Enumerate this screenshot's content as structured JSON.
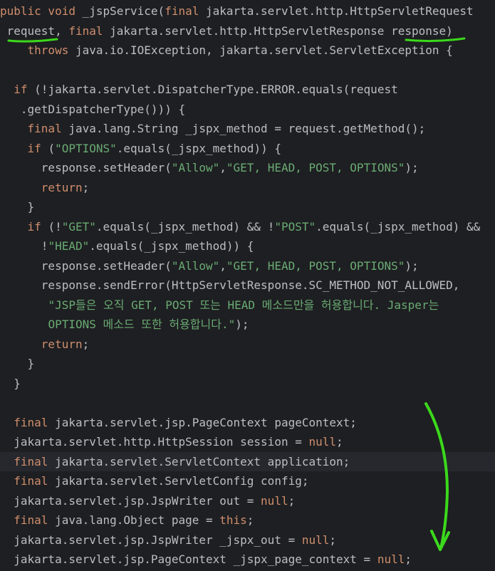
{
  "editor": {
    "language": "java",
    "current_line": 23,
    "colors": {
      "background": "#1e1f22",
      "current_line": "#26282e",
      "text": "#bcbec4",
      "keyword": "#cf8e6d",
      "string": "#6aab73",
      "annotation": "#3bd91b"
    },
    "lines": [
      [
        {
          "t": "public void ",
          "c": "kw"
        },
        {
          "t": "_jspService(",
          "c": "plain"
        },
        {
          "t": "final ",
          "c": "kw"
        },
        {
          "t": "jakarta.servlet.http.HttpServletRequest",
          "c": "plain"
        }
      ],
      [
        {
          "t": " request, ",
          "c": "plain"
        },
        {
          "t": "final ",
          "c": "kw"
        },
        {
          "t": "jakarta.servlet.http.HttpServletResponse response)",
          "c": "plain"
        }
      ],
      [
        {
          "t": "    ",
          "c": "plain"
        },
        {
          "t": "throws ",
          "c": "kw"
        },
        {
          "t": "java.io.IOException, jakarta.servlet.ServletException {",
          "c": "plain"
        }
      ],
      [],
      [
        {
          "t": "  ",
          "c": "plain"
        },
        {
          "t": "if ",
          "c": "kw"
        },
        {
          "t": "(!jakarta.servlet.DispatcherType.ERROR.equals(request",
          "c": "plain"
        }
      ],
      [
        {
          "t": "   .getDispatcherType())) {",
          "c": "plain"
        }
      ],
      [
        {
          "t": "    ",
          "c": "plain"
        },
        {
          "t": "final ",
          "c": "kw"
        },
        {
          "t": "java.lang.String _jspx_method = request.getMethod();",
          "c": "plain"
        }
      ],
      [
        {
          "t": "    ",
          "c": "plain"
        },
        {
          "t": "if ",
          "c": "kw"
        },
        {
          "t": "(",
          "c": "plain"
        },
        {
          "t": "\"OPTIONS\"",
          "c": "str"
        },
        {
          "t": ".equals(_jspx_method)) {",
          "c": "plain"
        }
      ],
      [
        {
          "t": "      response.setHeader(",
          "c": "plain"
        },
        {
          "t": "\"Allow\"",
          "c": "str"
        },
        {
          "t": ",",
          "c": "plain"
        },
        {
          "t": "\"GET, HEAD, POST, OPTIONS\"",
          "c": "str"
        },
        {
          "t": ");",
          "c": "plain"
        }
      ],
      [
        {
          "t": "      ",
          "c": "plain"
        },
        {
          "t": "return",
          "c": "kw"
        },
        {
          "t": ";",
          "c": "plain"
        }
      ],
      [
        {
          "t": "    }",
          "c": "plain"
        }
      ],
      [
        {
          "t": "    ",
          "c": "plain"
        },
        {
          "t": "if ",
          "c": "kw"
        },
        {
          "t": "(!",
          "c": "plain"
        },
        {
          "t": "\"GET\"",
          "c": "str"
        },
        {
          "t": ".equals(_jspx_method) && !",
          "c": "plain"
        },
        {
          "t": "\"POST\"",
          "c": "str"
        },
        {
          "t": ".equals(_jspx_method) &&",
          "c": "plain"
        }
      ],
      [
        {
          "t": "      !",
          "c": "plain"
        },
        {
          "t": "\"HEAD\"",
          "c": "str"
        },
        {
          "t": ".equals(_jspx_method)) {",
          "c": "plain"
        }
      ],
      [
        {
          "t": "      response.setHeader(",
          "c": "plain"
        },
        {
          "t": "\"Allow\"",
          "c": "str"
        },
        {
          "t": ",",
          "c": "plain"
        },
        {
          "t": "\"GET, HEAD, POST, OPTIONS\"",
          "c": "str"
        },
        {
          "t": ");",
          "c": "plain"
        }
      ],
      [
        {
          "t": "      response.sendError(HttpServletResponse.SC_METHOD_NOT_ALLOWED,",
          "c": "plain"
        }
      ],
      [
        {
          "t": "       ",
          "c": "plain"
        },
        {
          "t": "\"JSP들은 오직 GET, POST 또는 HEAD 메소드만을 허용합니다. Jasper는",
          "c": "str"
        }
      ],
      [
        {
          "t": "       ",
          "c": "plain"
        },
        {
          "t": "OPTIONS 메소드 또한 허용합니다.\"",
          "c": "str"
        },
        {
          "t": ");",
          "c": "plain"
        }
      ],
      [
        {
          "t": "      ",
          "c": "plain"
        },
        {
          "t": "return",
          "c": "kw"
        },
        {
          "t": ";",
          "c": "plain"
        }
      ],
      [
        {
          "t": "    }",
          "c": "plain"
        }
      ],
      [
        {
          "t": "  }",
          "c": "plain"
        }
      ],
      [],
      [
        {
          "t": "  ",
          "c": "plain"
        },
        {
          "t": "final ",
          "c": "kw"
        },
        {
          "t": "jakarta.servlet.jsp.PageContext pageContext;",
          "c": "plain"
        }
      ],
      [
        {
          "t": "  jakarta.servlet.http.HttpSession session = ",
          "c": "plain"
        },
        {
          "t": "null",
          "c": "kw"
        },
        {
          "t": ";",
          "c": "plain"
        }
      ],
      [
        {
          "t": "  ",
          "c": "plain"
        },
        {
          "t": "final ",
          "c": "kw"
        },
        {
          "t": "jakarta.servlet.ServletContext application;",
          "c": "plain"
        }
      ],
      [
        {
          "t": "  ",
          "c": "plain"
        },
        {
          "t": "final ",
          "c": "kw"
        },
        {
          "t": "jakarta.servlet.ServletConfig config;",
          "c": "plain"
        }
      ],
      [
        {
          "t": "  jakarta.servlet.jsp.JspWriter out = ",
          "c": "plain"
        },
        {
          "t": "null",
          "c": "kw"
        },
        {
          "t": ";",
          "c": "plain"
        }
      ],
      [
        {
          "t": "  ",
          "c": "plain"
        },
        {
          "t": "final ",
          "c": "kw"
        },
        {
          "t": "java.lang.Object page = ",
          "c": "plain"
        },
        {
          "t": "this",
          "c": "kw"
        },
        {
          "t": ";",
          "c": "plain"
        }
      ],
      [
        {
          "t": "  jakarta.servlet.jsp.JspWriter _jspx_out = ",
          "c": "plain"
        },
        {
          "t": "null",
          "c": "kw"
        },
        {
          "t": ";",
          "c": "plain"
        }
      ],
      [
        {
          "t": "  jakarta.servlet.jsp.PageContext _jspx_page_context = ",
          "c": "plain"
        },
        {
          "t": "null",
          "c": "kw"
        },
        {
          "t": ";",
          "c": "plain"
        }
      ]
    ]
  }
}
